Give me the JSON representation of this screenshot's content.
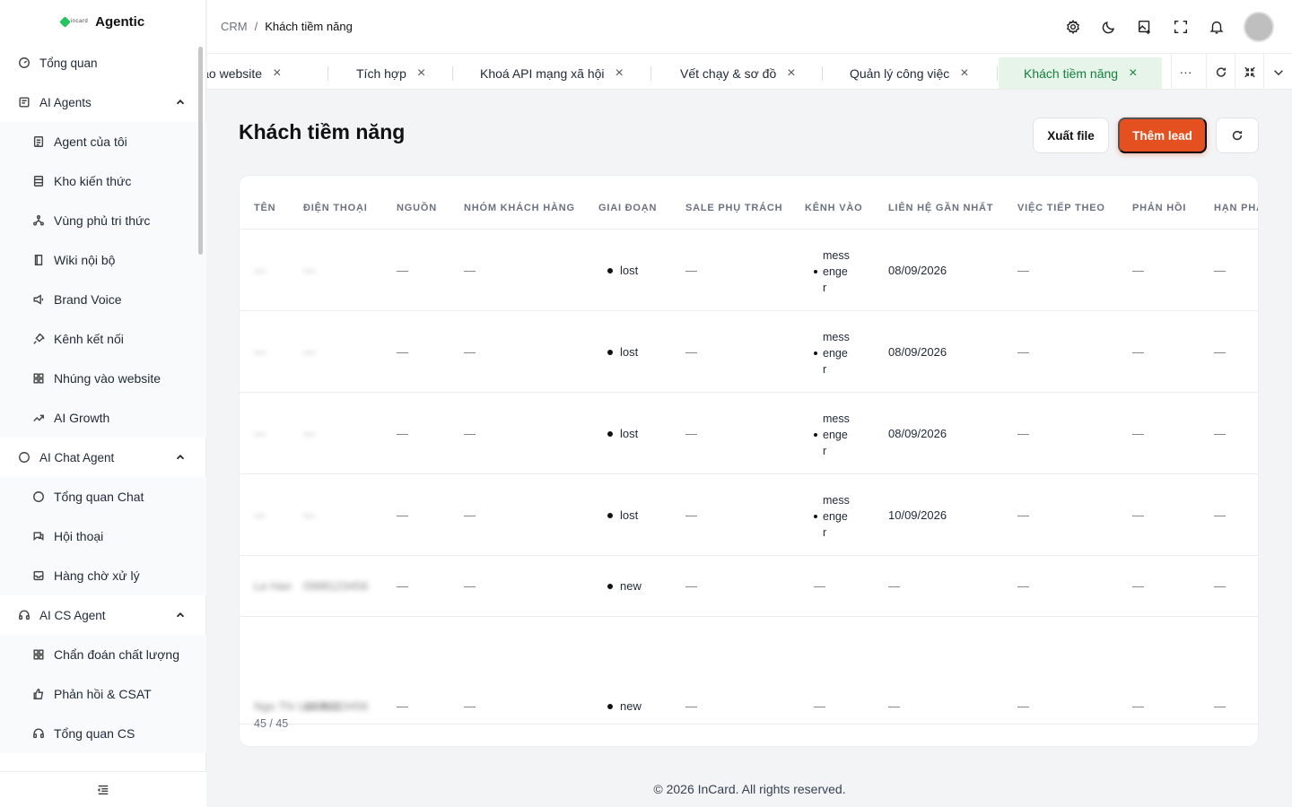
{
  "app": {
    "name": "Agentic",
    "logo_text": "incard"
  },
  "sidebar": {
    "items": [
      {
        "type": "top",
        "icon": "dashboard-icon",
        "label": "Tổng quan"
      },
      {
        "type": "top",
        "icon": "robot-icon",
        "label": "AI Agents",
        "expanded": true
      },
      {
        "type": "sub",
        "icon": "agent-icon",
        "label": "Agent của tôi"
      },
      {
        "type": "sub",
        "icon": "database-icon",
        "label": "Kho kiến thức"
      },
      {
        "type": "sub",
        "icon": "network-icon",
        "label": "Vùng phủ tri thức"
      },
      {
        "type": "sub",
        "icon": "book-icon",
        "label": "Wiki nội bộ"
      },
      {
        "type": "sub",
        "icon": "megaphone-icon",
        "label": "Brand Voice"
      },
      {
        "type": "sub",
        "icon": "plug-icon",
        "label": "Kênh kết nối"
      },
      {
        "type": "sub",
        "icon": "grid-icon",
        "label": "Nhúng vào website"
      },
      {
        "type": "sub",
        "icon": "trend-icon",
        "label": "AI Growth"
      },
      {
        "type": "top",
        "icon": "chat-icon",
        "label": "AI Chat Agent",
        "expanded": true
      },
      {
        "type": "sub",
        "icon": "chat-bubble-icon",
        "label": "Tổng quan Chat"
      },
      {
        "type": "sub",
        "icon": "conversation-icon",
        "label": "Hội thoại"
      },
      {
        "type": "sub",
        "icon": "inbox-icon",
        "label": "Hàng chờ xử lý"
      },
      {
        "type": "top",
        "icon": "headset-icon",
        "label": "AI CS Agent",
        "expanded": true
      },
      {
        "type": "sub",
        "icon": "grid-icon",
        "label": "Chẩn đoán chất lượng"
      },
      {
        "type": "sub",
        "icon": "thumbs-up-icon",
        "label": "Phản hồi & CSAT"
      },
      {
        "type": "sub",
        "icon": "headset-icon",
        "label": "Tổng quan CS"
      }
    ]
  },
  "header": {
    "breadcrumb": [
      "CRM",
      "Khách tiềm năng"
    ],
    "separator": "/"
  },
  "tabs": [
    {
      "label": "Nhúng vào website",
      "active": false
    },
    {
      "label": "Tích hợp",
      "active": false
    },
    {
      "label": "Khoá API mạng xã hội",
      "active": false
    },
    {
      "label": "Vết chạy & sơ đồ",
      "active": false
    },
    {
      "label": "Quản lý công việc",
      "active": false
    },
    {
      "label": "Khách tiềm năng",
      "active": true
    }
  ],
  "tab_controls": {
    "more": "···"
  },
  "page": {
    "title": "Khách tiềm năng",
    "export_label": "Xuất file",
    "add_label": "Thêm lead"
  },
  "table": {
    "columns": [
      "TÊN",
      "ĐIỆN THOẠI",
      "NGUỒN",
      "NHÓM KHÁCH HÀNG",
      "GIAI ĐOẠN",
      "SALE PHỤ TRÁCH",
      "KÊNH VÀO",
      "LIÊN HỆ GẦN NHẤT",
      "VIỆC TIẾP THEO",
      "PHẢN HỒI",
      "HẠN PHẢN HỒI"
    ],
    "rows": [
      {
        "name": "—",
        "phone": "—",
        "source": "—",
        "group": "—",
        "stage": "lost",
        "sale": "—",
        "channel": "messenger",
        "last_contact": "08/09/2026",
        "next": "—",
        "reply": "—",
        "deadline": "—"
      },
      {
        "name": "—",
        "phone": "—",
        "source": "—",
        "group": "—",
        "stage": "lost",
        "sale": "—",
        "channel": "messenger",
        "last_contact": "08/09/2026",
        "next": "—",
        "reply": "—",
        "deadline": "—"
      },
      {
        "name": "—",
        "phone": "—",
        "source": "—",
        "group": "—",
        "stage": "lost",
        "sale": "—",
        "channel": "messenger",
        "last_contact": "08/09/2026",
        "next": "—",
        "reply": "—",
        "deadline": "—"
      },
      {
        "name": "—",
        "phone": "—",
        "source": "—",
        "group": "—",
        "stage": "lost",
        "sale": "—",
        "channel": "messenger",
        "last_contact": "10/09/2026",
        "next": "—",
        "reply": "—",
        "deadline": "—"
      },
      {
        "name": "Le Han",
        "phone": "0988123456",
        "source": "—",
        "group": "—",
        "stage": "new",
        "sale": "—",
        "channel": "—",
        "last_contact": "—",
        "next": "—",
        "reply": "—",
        "deadline": "—"
      },
      {
        "name": "Ngo Thi Lan Anh",
        "phone": "0398123456",
        "source": "—",
        "group": "—",
        "stage": "new",
        "sale": "—",
        "channel": "—",
        "last_contact": "—",
        "next": "—",
        "reply": "—",
        "deadline": "—"
      }
    ],
    "count": "45 / 45"
  },
  "footer": {
    "text": "© 2026 InCard. All rights reserved."
  }
}
